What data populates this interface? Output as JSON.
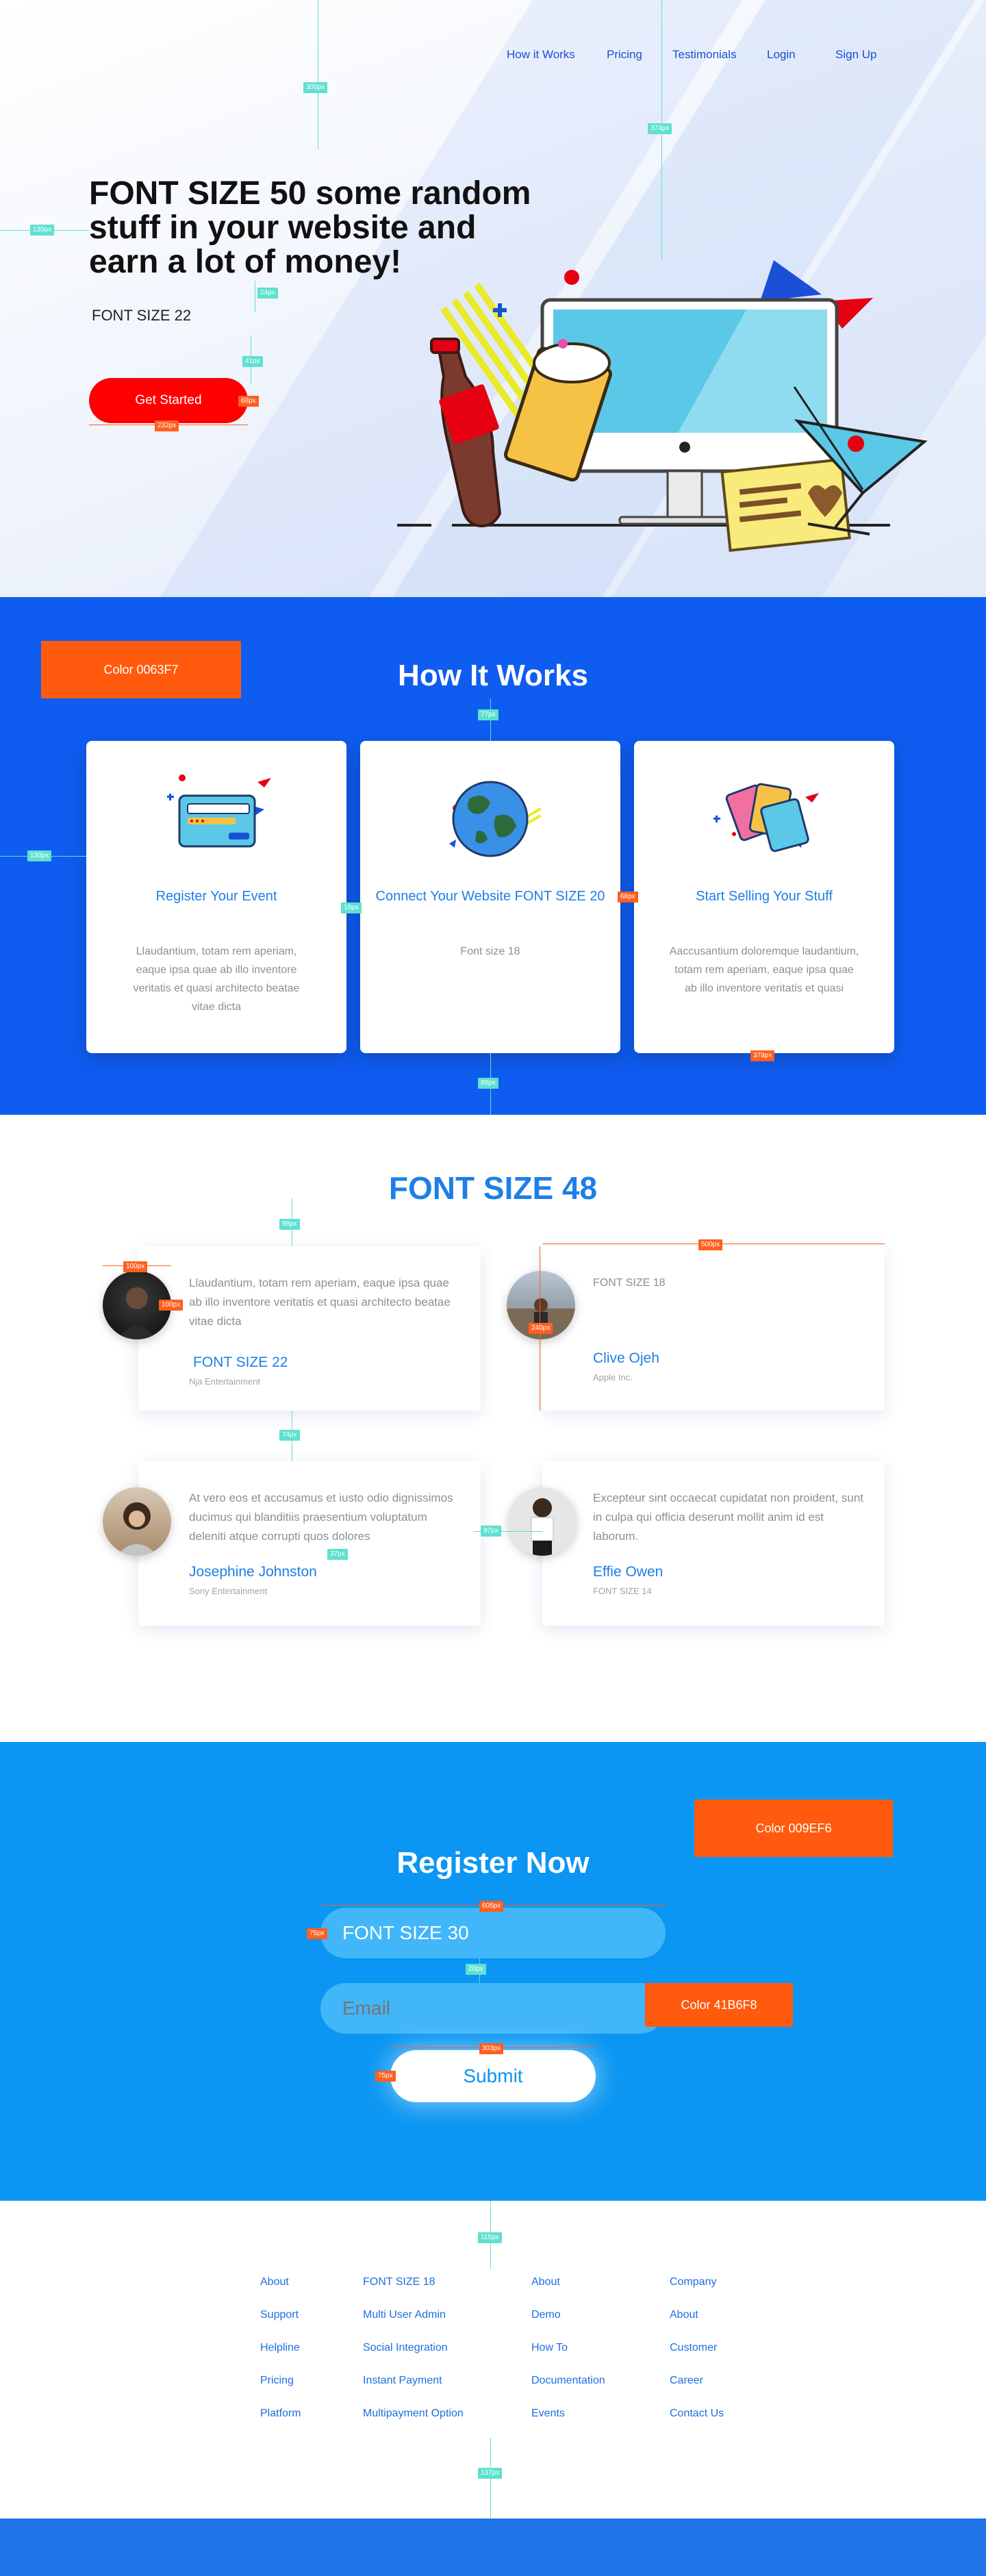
{
  "nav": {
    "items": [
      "How it Works",
      "Pricing",
      "Testimonials",
      "Login",
      "Sign Up"
    ]
  },
  "hero": {
    "title": "FONT SIZE 50 some random stuff in your website and earn a lot of money!",
    "subtitle": "FONT SIZE 22",
    "cta": "Get Started",
    "button_color": "#ff0000"
  },
  "annotations": {
    "hero": [
      "300px",
      "374px",
      "130px",
      "24px",
      "41px",
      "68px",
      "232px"
    ],
    "how": [
      "77px",
      "130px",
      "10px",
      "68px",
      "88px",
      "378px"
    ],
    "testimonials": [
      "88px",
      "100px",
      "100px",
      "74px",
      "500px",
      "240px",
      "37px",
      "97px"
    ],
    "register": [
      "605px",
      "75px",
      "20px",
      "303px",
      "75px"
    ],
    "footer": [
      "115px",
      "137px"
    ]
  },
  "how": {
    "color_label": "Color 0063F7",
    "title": "How It Works",
    "steps": [
      {
        "title": "Register Your Event",
        "desc": "Llaudantium, totam rem aperiam, eaque ipsa quae ab illo inventore veritatis et quasi architecto beatae vitae dicta",
        "icon": "credit-card-icon"
      },
      {
        "title": "Connect Your Website FONT SIZE 20",
        "desc": "Font size 18",
        "icon": "globe-icon"
      },
      {
        "title": "Start Selling Your Stuff",
        "desc": "Aaccusantium doloremque laudantium, totam rem aperiam, eaque ipsa quae ab illo inventore veritatis et quasi",
        "icon": "tickets-icon"
      }
    ]
  },
  "testimonials": {
    "title": "FONT SIZE 48",
    "items": [
      {
        "quote": "Llaudantium, totam rem aperiam, eaque ipsa quae ab illo inventore veritatis et quasi architecto beatae vitae dicta",
        "name": "FONT SIZE 22",
        "company": "Nja Entertainment"
      },
      {
        "quote": "FONT SIZE 18",
        "name": "Clive Ojeh",
        "company": "Apple Inc."
      },
      {
        "quote": "At vero eos et accusamus et iusto odio dignissimos ducimus qui blanditiis praesentium voluptatum deleniti atque corrupti quos dolores",
        "name": "Josephine Johnston",
        "company": "Sony Entertainment"
      },
      {
        "quote": "Excepteur sint occaecat cupidatat non proident, sunt in culpa qui officia deserunt mollit anim id est laborum.",
        "name": "Effie Owen",
        "company": "FONT SIZE 14"
      }
    ]
  },
  "register": {
    "color_label": "Color 009EF6",
    "title": "Register Now",
    "name_field": "FONT SIZE 30",
    "email_field": "Email",
    "field_color_label": "Color 41B6F8",
    "submit": "Submit"
  },
  "footer": {
    "columns": [
      [
        "About",
        "Support",
        "Helpline",
        "Pricing",
        "Platform"
      ],
      [
        "FONT SIZE 18",
        "Multi User Admin",
        "Social Integration",
        "Instant Payment",
        "Multipayment Option"
      ],
      [
        "About",
        "Demo",
        "How To",
        "Documentation",
        "Events"
      ],
      [
        "Company",
        "About",
        "Customer",
        "Career",
        "Contact Us"
      ]
    ]
  }
}
